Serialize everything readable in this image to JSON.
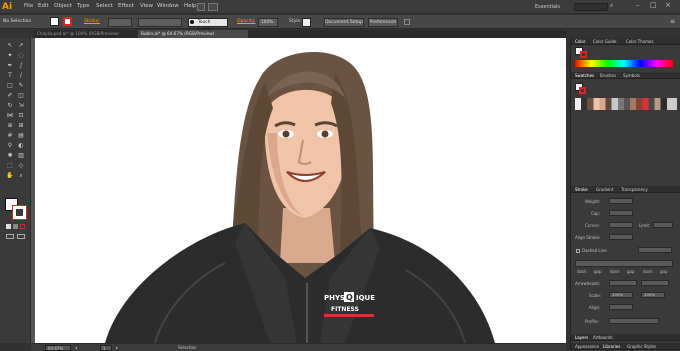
{
  "app": {
    "logo": "Ai"
  },
  "menu": [
    "File",
    "Edit",
    "Object",
    "Type",
    "Select",
    "Effect",
    "View",
    "Window",
    "Help"
  ],
  "workspace": "Essentials",
  "control_bar": {
    "selection": "No Selection",
    "stroke_label": "Stroke:",
    "brush": "Touch Callig...",
    "opacity_label": "Opacity:",
    "opacity_value": "100%",
    "style_label": "Style:",
    "doc_setup": "Document Setup",
    "preferences": "Preferences"
  },
  "tabs": [
    "Chaylia.psd.ai* @ 100% (RGB/Preview)",
    "Bubin.ai* @ 64.67% (RGB/Preview)"
  ],
  "artwork": {
    "logo_line1": "PHYS",
    "logo_mark": "Q",
    "logo_line1b": "IQUE",
    "logo_line2": "FITNESS"
  },
  "status": {
    "zoom": "64.67%",
    "page": "1",
    "mode": "Selection"
  },
  "panels": {
    "color_tabs": [
      "Color",
      "Color Guide",
      "Color Themes"
    ],
    "swatch_tabs": [
      "Swatches",
      "Brushes",
      "Symbols"
    ],
    "stroke_tabs": [
      "Stroke",
      "Gradient",
      "Transparency"
    ],
    "stroke": {
      "weight": "Weight:",
      "cap": "Cap:",
      "corner": "Corner:",
      "limit": "Limit:",
      "align": "Align Stroke:",
      "dashed": "Dashed Line",
      "dash_cols": [
        "dash",
        "gap",
        "dash",
        "gap",
        "dash",
        "gap"
      ],
      "arrowheads": "Arrowheads:",
      "scale": "Scale:",
      "scale_a": "100%",
      "scale_b": "100%",
      "align2": "Align:",
      "profile": "Profile:"
    },
    "bottom_tabs": [
      "Layers",
      "Artboards"
    ],
    "bottom_tabs2": [
      "Appearance",
      "Libraries",
      "Graphic Styles"
    ]
  },
  "colors": {
    "accent": "#ff9a00",
    "shirt": "#2c2c2c",
    "hair": "#6a5340",
    "skin": "#efc4a8",
    "logo_red": "#e03030"
  }
}
